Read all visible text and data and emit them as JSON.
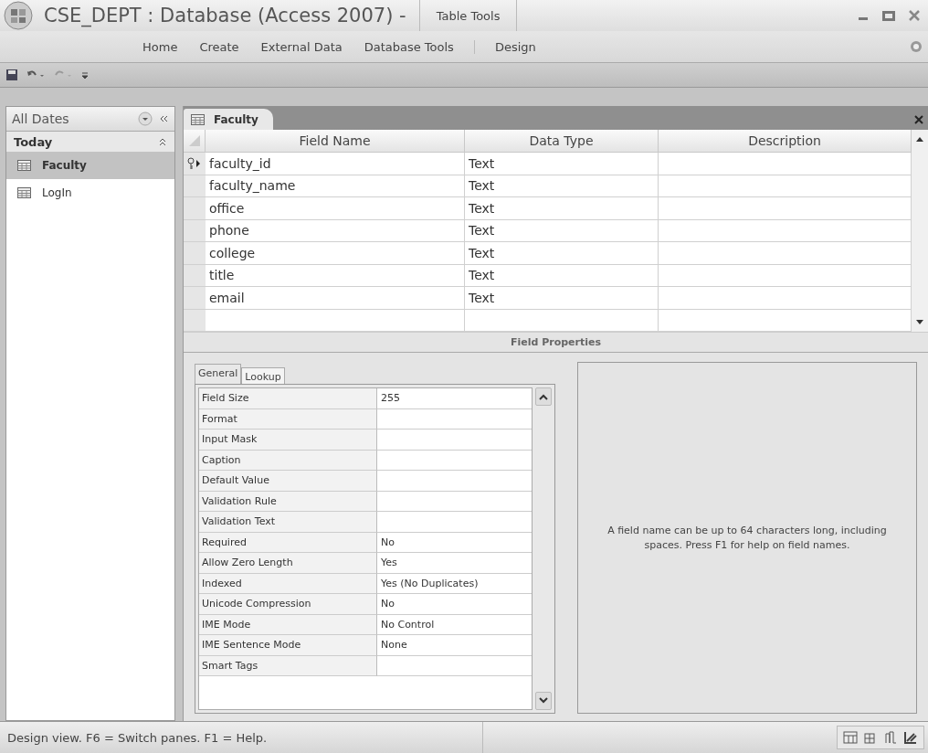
{
  "window": {
    "title": "CSE_DEPT : Database (Access 2007) -",
    "contextual_group": "Table Tools"
  },
  "ribbon_tabs": [
    {
      "label": "Home",
      "contextual": false
    },
    {
      "label": "Create",
      "contextual": false
    },
    {
      "label": "External Data",
      "contextual": false
    },
    {
      "label": "Database Tools",
      "contextual": false
    },
    {
      "label": "Design",
      "contextual": true
    }
  ],
  "nav_pane": {
    "header": "All Dates",
    "groups": [
      {
        "label": "Today",
        "expanded": true,
        "items": [
          {
            "label": "Faculty",
            "selected": true
          },
          {
            "label": "LogIn",
            "selected": false
          }
        ]
      }
    ]
  },
  "document_tab": {
    "label": "Faculty"
  },
  "table": {
    "columns": [
      "Field Name",
      "Data Type",
      "Description"
    ],
    "rows": [
      {
        "field_name": "faculty_id",
        "data_type": "Text",
        "primary_key": true,
        "current": true
      },
      {
        "field_name": "faculty_name",
        "data_type": "Text",
        "primary_key": false,
        "current": false
      },
      {
        "field_name": "office",
        "data_type": "Text",
        "primary_key": false,
        "current": false
      },
      {
        "field_name": "phone",
        "data_type": "Text",
        "primary_key": false,
        "current": false
      },
      {
        "field_name": "college",
        "data_type": "Text",
        "primary_key": false,
        "current": false
      },
      {
        "field_name": "title",
        "data_type": "Text",
        "primary_key": false,
        "current": false
      },
      {
        "field_name": "email",
        "data_type": "Text",
        "primary_key": false,
        "current": false
      }
    ]
  },
  "field_properties": {
    "title": "Field Properties",
    "tabs": [
      {
        "label": "General",
        "selected": true
      },
      {
        "label": "Lookup",
        "selected": false
      }
    ],
    "properties": [
      {
        "name": "Field Size",
        "value": "255"
      },
      {
        "name": "Format"
      },
      {
        "name": "Input Mask"
      },
      {
        "name": "Caption"
      },
      {
        "name": "Default Value"
      },
      {
        "name": "Validation Rule"
      },
      {
        "name": "Validation Text"
      },
      {
        "name": "Required",
        "value": "No"
      },
      {
        "name": "Allow Zero Length",
        "value": "Yes"
      },
      {
        "name": "Indexed",
        "value": "Yes (No Duplicates)"
      },
      {
        "name": "Unicode Compression",
        "value": "No"
      },
      {
        "name": "IME Mode",
        "value": "No Control"
      },
      {
        "name": "IME Sentence Mode",
        "value": "None"
      },
      {
        "name": "Smart Tags"
      }
    ],
    "help_text": "A field name can be up to 64 characters long, including spaces.  Press F1 for help on field names."
  },
  "status_bar": {
    "text": "Design view.  F6 = Switch panes.  F1 = Help."
  }
}
